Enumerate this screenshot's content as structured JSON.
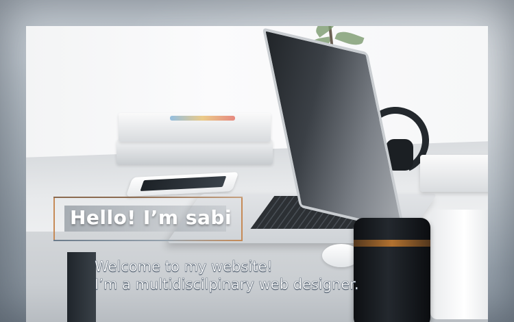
{
  "hero": {
    "title": "Hello! I’m sabi",
    "subtitle_line1": "Welcome to my website!",
    "subtitle_line2": "I’m a multidiscilpinary web designer."
  },
  "colors": {
    "title_text": "#ffffff",
    "frame_accent": "#c68a56",
    "subtitle_outline": "#3e4d5f"
  },
  "icons": {
    "decor": [
      "photo-background"
    ]
  }
}
